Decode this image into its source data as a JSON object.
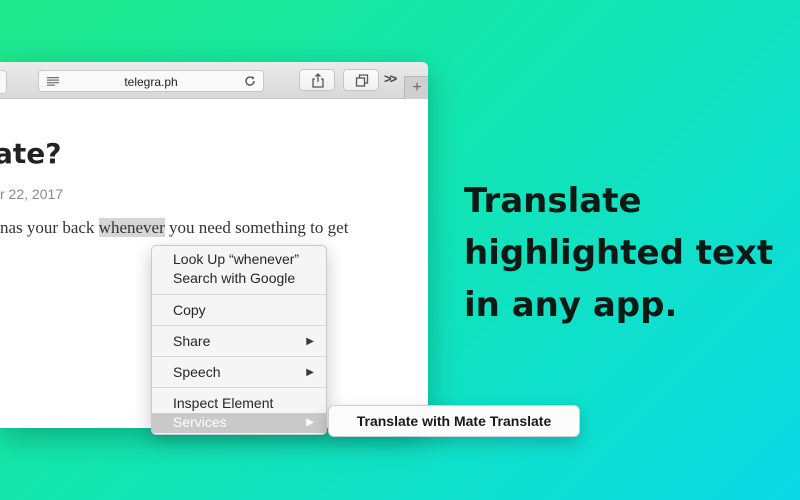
{
  "browser": {
    "url": "telegra.ph",
    "plus_label": "+",
    "chevron_label": ">>"
  },
  "article": {
    "title": "ate?",
    "date": "r 22, 2017",
    "text_before": "nas your back ",
    "text_highlight": "whenever",
    "text_after": " you need something to get"
  },
  "context_menu": {
    "look_up": "Look Up “whenever”",
    "search_google": "Search with Google",
    "copy": "Copy",
    "share": "Share",
    "speech": "Speech",
    "inspect_element": "Inspect Element",
    "services": "Services",
    "arrow": "▶"
  },
  "services_submenu": {
    "item": "Translate with Mate Translate"
  },
  "headline": {
    "line1": "Translate",
    "line2": "highlighted text",
    "line3": "in any app."
  }
}
